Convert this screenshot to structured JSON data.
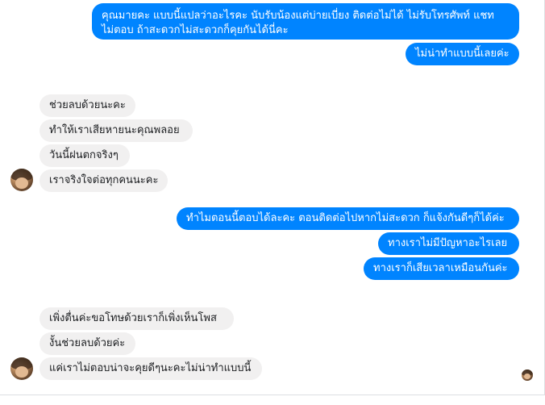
{
  "outgoing_1": {
    "line1": "คุณมายคะ แบบนี้แปลว่าอะไรคะ นับรับน้องแต่บ่ายเบี่ยง ติดต่อไม่ได้ ไม่รับโทรศัพท์ แชท",
    "line2": "ไม่ตอบ ถ้าสะดวกไม่สะดวกก็คุยกันได้นี่คะ"
  },
  "outgoing_2": "ไม่น่าทำแบบนี้เลยค่ะ",
  "incoming_group_1": [
    "ช่วยลบด้วยนะคะ",
    "ทำให้เราเสียหายนะคุณพลอย",
    "วันนี้ฝนตกจริงๆ",
    "เราจริงใจต่อทุกคนนะคะ"
  ],
  "outgoing_group_2": [
    "ทำไมตอนนี้ตอบได้ละคะ ตอนติดต่อไปหากไม่สะดวก ก็แจ้งกันดีๆก็ได้ค่ะ",
    "ทางเราไม่มีปัญหาอะไรเลย",
    "ทางเราก็เสียเวลาเหมือนกันค่ะ"
  ],
  "incoming_group_2": [
    "เพิ่งตื่นค่ะขอโทษด้วยเราก็เพิ่งเห็นโพส",
    "งั้นช่วยลบด้วยค่ะ",
    "แค่เราไม่ตอบน่าจะคุยดีๆนะคะไม่น่าทำแบบนี้"
  ],
  "colors": {
    "outgoing_bubble": "#0084ff",
    "incoming_bubble": "#f1f0f0"
  },
  "icons": {
    "contact_avatar": "contact-avatar",
    "seen_avatar": "seen-avatar"
  }
}
